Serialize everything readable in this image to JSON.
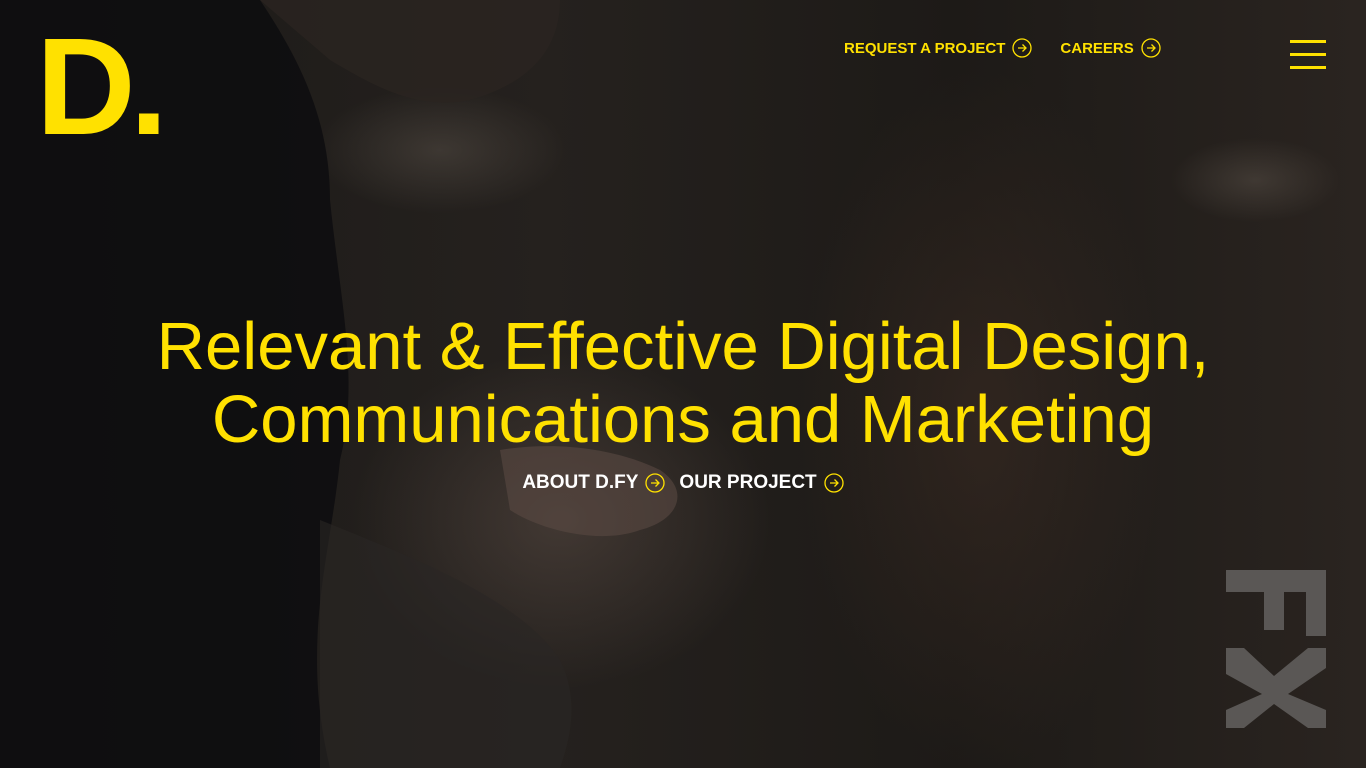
{
  "brand": {
    "logo_text": "D.",
    "side_mark": "FY",
    "accent_color": "#ffe100"
  },
  "topnav": {
    "items": [
      {
        "label": "REQUEST A PROJECT",
        "icon": "arrow-right-circle-icon"
      },
      {
        "label": "CAREERS",
        "icon": "arrow-right-circle-icon"
      }
    ],
    "menu_icon": "hamburger-menu-icon"
  },
  "hero": {
    "headline_line1": "Relevant & Effective Digital Design,",
    "headline_line2": "Communications and Marketing",
    "links": [
      {
        "label": "ABOUT D.FY",
        "icon": "arrow-right-circle-icon"
      },
      {
        "label": "OUR PROJECT",
        "icon": "arrow-right-circle-icon"
      }
    ]
  }
}
